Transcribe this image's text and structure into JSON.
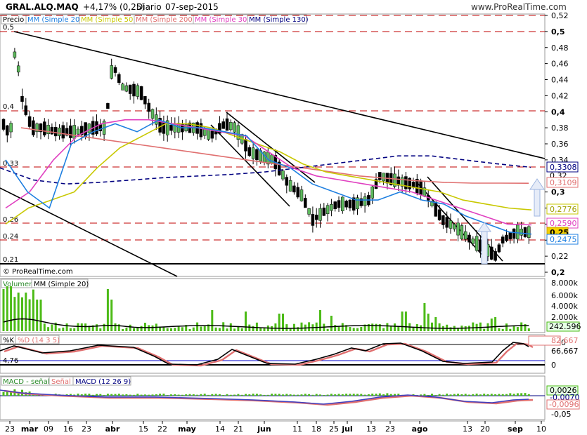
{
  "header": {
    "ticker": "GRAL.ALQ.MAQ",
    "change": "+4,17% (0,25)",
    "period": "Diario",
    "date": "07-sep-2015",
    "site": "www.ProRealTime.com"
  },
  "legend": {
    "price": "Precio",
    "mm20": "MM (Simple 20)",
    "mm50": "MM (Simple 50)",
    "mm200": "MM (Simple 200)",
    "mm30": "MM (Simple 30)",
    "mm130": "MM (Simple 130)"
  },
  "copyright": "© ProRealTime.com",
  "colors": {
    "mm20": "#1e7fe0",
    "mm50": "#c8c800",
    "mm200": "#e07070",
    "mm30": "#e040c0",
    "mm130": "#000080",
    "up": "#5cb85c",
    "down": "#000000",
    "dashed": "#c00000",
    "volume": "#4cbb17",
    "k": "#000000",
    "d": "#e07070"
  },
  "price_panel": {
    "ylim": [
      0.2,
      0.52
    ],
    "yticks": [
      "0,52",
      "0,5",
      "0,48",
      "0,46",
      "0,44",
      "0,42",
      "0,4",
      "0,38",
      "0,36",
      "0,34",
      "0,3",
      "0,28",
      "0,26",
      "0,24",
      "0,22",
      "0,2"
    ],
    "left_labels": [
      "0,5",
      "0,4",
      "0,33",
      "0,26",
      "0,24",
      "0,21"
    ],
    "value_tags": [
      {
        "text": "0,3308",
        "color": "#000080"
      },
      {
        "text": "0,32",
        "color": "#000000"
      },
      {
        "text": "0,3109",
        "color": "#e07070"
      },
      {
        "text": "0,2776",
        "color": "#c8c800"
      },
      {
        "text": "0,2590",
        "color": "#e040c0"
      },
      {
        "text": "0,25",
        "color": "#e8c000"
      },
      {
        "text": "0,2475",
        "color": "#1e7fe0"
      }
    ]
  },
  "volume_panel": {
    "label_a": "Volumen",
    "label_b": "MM (Simple 20)",
    "yticks": [
      "8.000k",
      "6.000k",
      "4.000k",
      "2.000k"
    ],
    "tag": "242.596"
  },
  "stoch_panel": {
    "label_a": "%K",
    "label_b": "%D (14 3 5)",
    "tags": [
      "82,667",
      "66,667"
    ],
    "yticks": [
      "100",
      "0"
    ],
    "left_label": "4,76"
  },
  "macd_panel": {
    "label_a": "MACD - señal",
    "label_b": "Señal",
    "label_c": "MACD (12 26 9)",
    "tags": [
      "0,0026",
      "-0,0070",
      "-0,0096"
    ],
    "yticks": [
      "-0,05"
    ]
  },
  "xaxis": [
    "23",
    "mar",
    "09",
    "16",
    "23",
    "abr",
    "15",
    "22",
    "may",
    "14",
    "21",
    "jun",
    "11",
    "18",
    "25",
    "jul",
    "13",
    "23",
    "ago",
    "13",
    "20",
    "sep",
    "10"
  ],
  "chart_data": {
    "type": "candlestick",
    "title": "GRAL.ALQ.MAQ",
    "ylim": [
      0.2,
      0.52
    ],
    "start": "2015-02-23",
    "end": "2015-09-07",
    "last_close": 0.25,
    "support_lines": [
      0.5,
      0.4,
      0.33,
      0.26,
      0.24,
      0.21
    ],
    "series": [
      {
        "name": "MM (Simple 20)",
        "values": [
          0.34,
          0.3,
          0.28,
          0.36,
          0.375,
          0.385,
          0.375,
          0.39,
          0.38,
          0.38,
          0.375,
          0.37,
          0.34,
          0.33,
          0.31,
          0.3,
          0.29,
          0.29,
          0.3,
          0.29,
          0.285,
          0.27,
          0.26,
          0.25,
          0.2475
        ]
      },
      {
        "name": "MM (Simple 50)",
        "values": [
          0.26,
          0.28,
          0.29,
          0.3,
          0.33,
          0.355,
          0.37,
          0.385,
          0.385,
          0.38,
          0.37,
          0.36,
          0.35,
          0.335,
          0.325,
          0.32,
          0.315,
          0.31,
          0.305,
          0.3,
          0.29,
          0.285,
          0.28,
          0.2776
        ]
      },
      {
        "name": "MM (Simple 200)",
        "values": [
          0.38,
          0.375,
          0.37,
          0.365,
          0.36,
          0.355,
          0.35,
          0.345,
          0.34,
          0.335,
          0.33,
          0.325,
          0.32,
          0.317,
          0.314,
          0.312,
          0.311,
          0.311,
          0.3109
        ]
      },
      {
        "name": "MM (Simple 30)",
        "values": [
          0.28,
          0.3,
          0.34,
          0.37,
          0.385,
          0.39,
          0.39,
          0.385,
          0.38,
          0.375,
          0.37,
          0.35,
          0.33,
          0.32,
          0.315,
          0.31,
          0.305,
          0.3,
          0.29,
          0.28,
          0.27,
          0.26,
          0.259
        ]
      },
      {
        "name": "MM (Simple 130)",
        "values": [
          0.33,
          0.315,
          0.31,
          0.312,
          0.315,
          0.318,
          0.32,
          0.322,
          0.325,
          0.33,
          0.335,
          0.34,
          0.345,
          0.345,
          0.34,
          0.335,
          0.3308
        ]
      }
    ]
  }
}
